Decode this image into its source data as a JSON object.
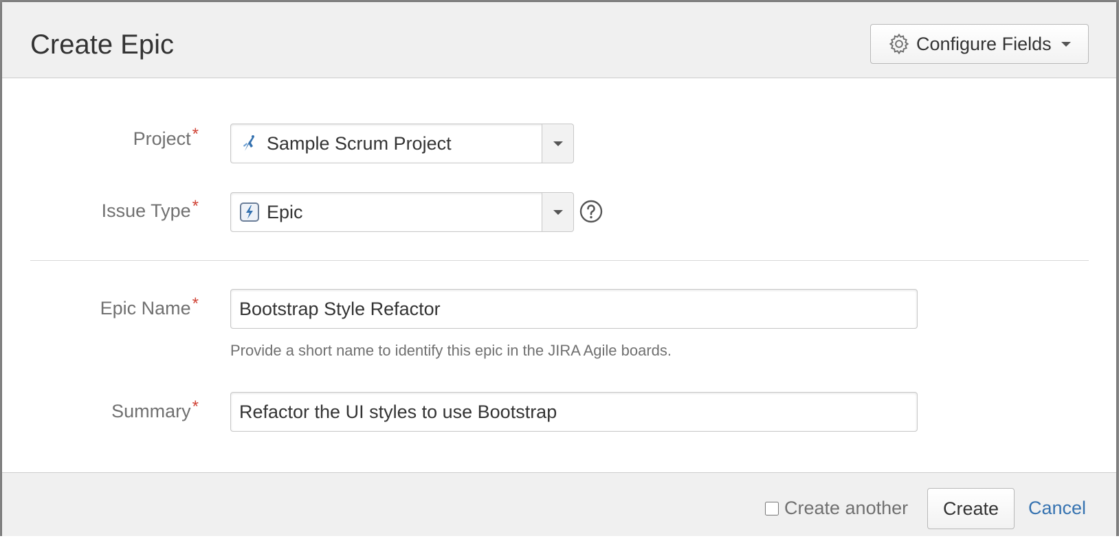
{
  "dialog": {
    "title": "Create Epic",
    "configure_fields_label": "Configure Fields",
    "configure_fields_icon": "gear-icon"
  },
  "form": {
    "project": {
      "label": "Project",
      "required_mark": "*",
      "value": "Sample Scrum Project",
      "icon": "project-avatar-icon"
    },
    "issue_type": {
      "label": "Issue Type",
      "required_mark": "*",
      "value": "Epic",
      "icon": "epic-icon",
      "help_icon": "help-icon"
    },
    "epic_name": {
      "label": "Epic Name",
      "required_mark": "*",
      "value": "Bootstrap Style Refactor",
      "help_text": "Provide a short name to identify this epic in the JIRA Agile boards."
    },
    "summary": {
      "label": "Summary",
      "required_mark": "*",
      "value": "Refactor the UI styles to use Bootstrap"
    }
  },
  "footer": {
    "create_another_label": "Create another",
    "create_another_checked": false,
    "create_label": "Create",
    "cancel_label": "Cancel"
  },
  "colors": {
    "required": "#d04437",
    "link": "#3572b0",
    "header_bg": "#f0f0f0",
    "label_text": "#707070"
  }
}
